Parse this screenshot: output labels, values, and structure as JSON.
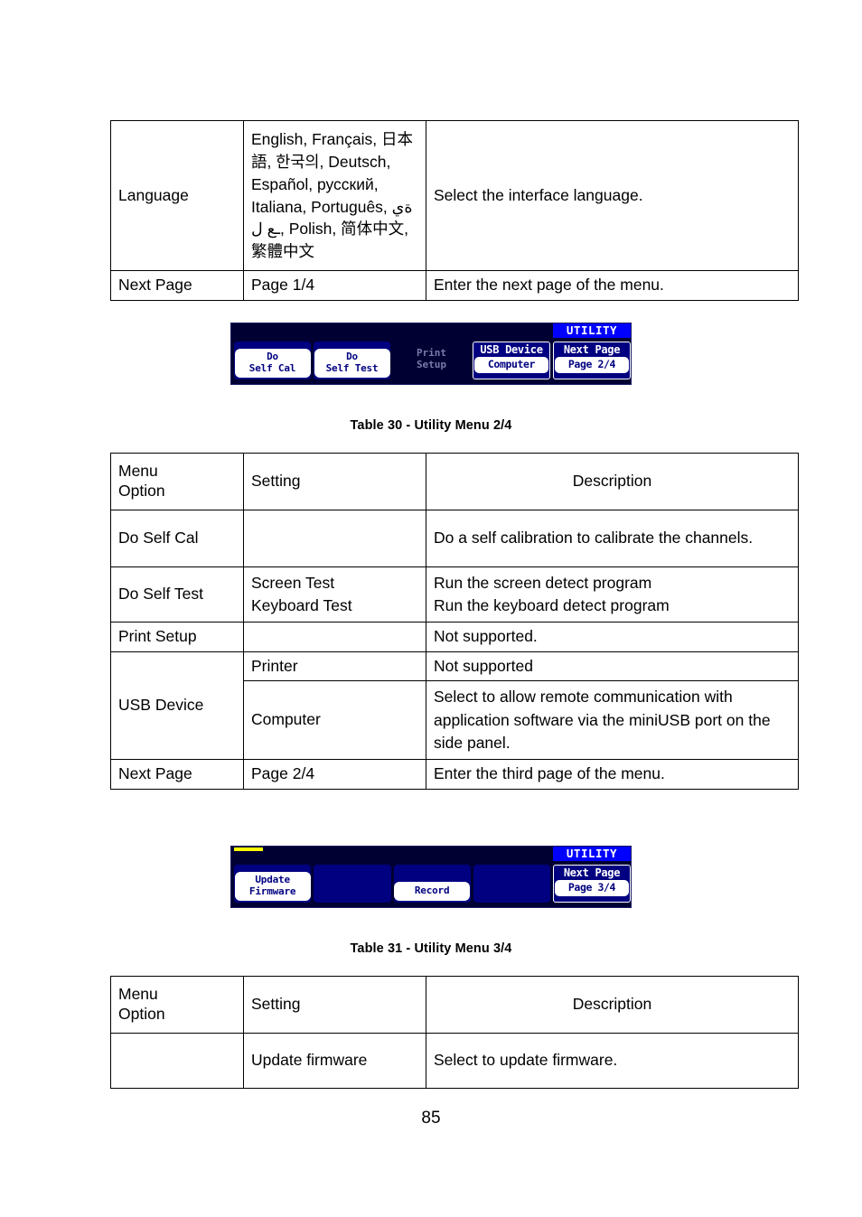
{
  "document": {
    "page_number": "85"
  },
  "table_29": {
    "rows": [
      {
        "option": "Language",
        "setting": "English, Français, 日本語, 한국의, Deutsch, Español, русский, Italiana, Português, ةي ـع ل, Polish, 简体中文, 繁體中文",
        "description": "Select the interface language."
      },
      {
        "option": "Next Page",
        "setting": "Page 1/4",
        "description": "Enter the next page of the menu."
      }
    ]
  },
  "scope_1": {
    "title": "UTILITY",
    "keys": [
      {
        "line1": "Do",
        "line2": "Self Cal",
        "state": "active"
      },
      {
        "line1": "Do",
        "line2": "Self Test",
        "state": "active"
      },
      {
        "line1": "Print",
        "line2": "Setup",
        "state": "disabled"
      },
      {
        "head": "USB Device",
        "value": "Computer",
        "state": "stacked"
      },
      {
        "head": "Next Page",
        "value": "Page 2/4",
        "state": "stacked"
      }
    ]
  },
  "caption_30": "Table 30 - Utility Menu 2/4",
  "table_30": {
    "headers": [
      "Menu Option",
      "Setting",
      "Description"
    ],
    "header_lines": [
      [
        "Menu",
        "Option"
      ],
      [
        "Setting"
      ],
      [
        "Description"
      ]
    ],
    "rows": [
      {
        "option": "Do Self Cal",
        "setting": "",
        "description": "Do a self calibration to calibrate the channels."
      },
      {
        "option": "Do Self Test",
        "setting_line1": "Screen Test",
        "setting_line2": "Keyboard Test",
        "description_line1": "Run the screen detect program",
        "description_line2": "Run the keyboard detect program"
      },
      {
        "option": "Print Setup",
        "setting": "",
        "description": "Not supported."
      },
      {
        "option": "USB Device",
        "setting_a": "Printer",
        "description_a": "Not supported",
        "setting_b": "Computer",
        "description_b": "Select to allow remote communication with application software via the miniUSB port on the side panel."
      },
      {
        "option": "Next Page",
        "setting": "Page 2/4",
        "description": "Enter the third page of the menu."
      }
    ]
  },
  "scope_2": {
    "title": "UTILITY",
    "keys": [
      {
        "line1": "Update",
        "line2": "Firmware",
        "state": "active"
      },
      {
        "state": "blank"
      },
      {
        "line1": "Record",
        "state": "active-one-line"
      },
      {
        "state": "blank"
      },
      {
        "head": "Next Page",
        "value": "Page 3/4",
        "state": "stacked"
      }
    ]
  },
  "caption_31": "Table 31 - Utility Menu 3/4",
  "table_31": {
    "header_lines": [
      [
        "Menu",
        "Option"
      ],
      [
        "Setting"
      ],
      [
        "Description"
      ]
    ],
    "rows": [
      {
        "option": "",
        "setting": "Update firmware",
        "description": "Select to update firmware."
      }
    ]
  }
}
